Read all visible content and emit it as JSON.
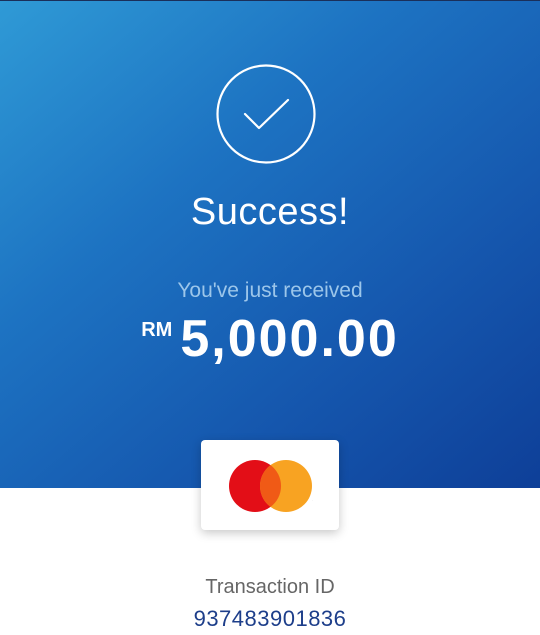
{
  "success": {
    "icon": "check-circle-icon",
    "title": "Success!",
    "subtitle": "You've just received",
    "currency": "RM",
    "amount": "5,000.00"
  },
  "payment_card": {
    "brand_icon": "mastercard-logo-icon"
  },
  "transaction": {
    "label": "Transaction ID",
    "id": "937483901836"
  },
  "colors": {
    "gradient_start": "#2f9ad6",
    "gradient_end": "#0e3f98",
    "subtitle_text": "#9cc6ea",
    "transaction_id_text": "#1d3e8a",
    "mastercard_red": "#e30e17",
    "mastercard_orange": "#f8a01b"
  }
}
